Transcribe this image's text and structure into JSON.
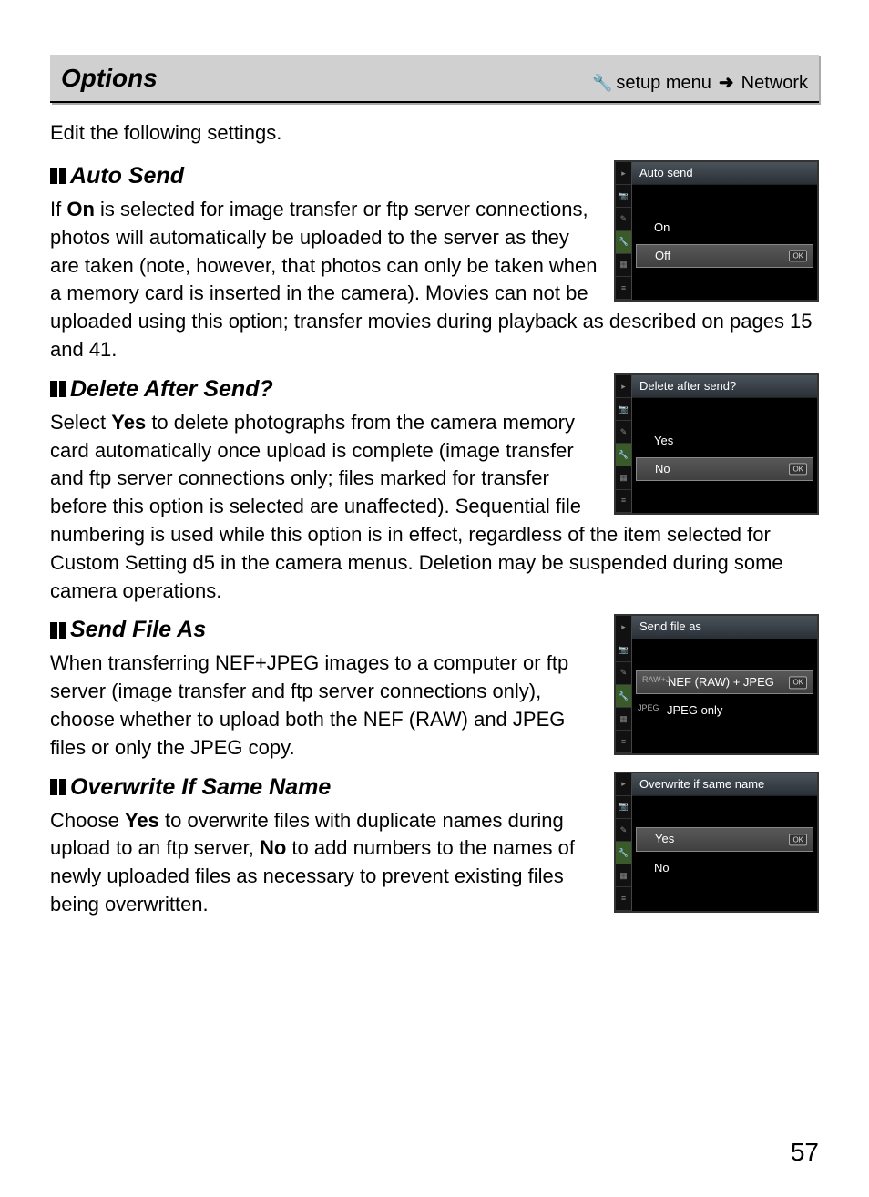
{
  "header": {
    "title": "Options",
    "breadcrumb_setup": "setup menu",
    "breadcrumb_network": "Network"
  },
  "intro": "Edit the following settings.",
  "sections": {
    "auto_send": {
      "title": "Auto Send",
      "body_pre": "If ",
      "body_on": "On",
      "body_post": " is selected for image transfer or ftp server connections, photos will automatically be uploaded to the server as they are taken (note, however, that photos can only be taken when a memory card is inserted in the camera). Movies can not be uploaded using this option; transfer movies during playback as described on pages 15 and 41.",
      "shot": {
        "title": "Auto send",
        "opt1": "On",
        "opt2": "Off",
        "selected": 2
      }
    },
    "delete_after": {
      "title": "Delete After Send?",
      "body_pre": "Select ",
      "body_yes": "Yes",
      "body_post": " to delete photographs from the camera memory card automatically once upload is complete (image transfer and ftp server connections only; files marked for transfer before this option is selected are unaffected). Sequential file numbering is used while this option is in effect, regardless of the item selected for Custom Setting d5 in the camera menus. Deletion may be suspended during some camera operations.",
      "shot": {
        "title": "Delete after send?",
        "opt1": "Yes",
        "opt2": "No",
        "selected": 2
      }
    },
    "send_file_as": {
      "title": "Send File As",
      "body": "When transferring NEF+JPEG images to a computer or ftp server (image transfer and ftp server connections only), choose whether to upload both the NEF (RAW) and JPEG files or only the JPEG copy.",
      "shot": {
        "title": "Send file as",
        "opt1p": "RAW+J",
        "opt1": "NEF (RAW) + JPEG",
        "opt2p": "JPEG",
        "opt2": "JPEG only",
        "selected": 1
      }
    },
    "overwrite": {
      "title": "Overwrite If Same Name",
      "body_pre": "Choose ",
      "body_yes": "Yes",
      "body_mid": " to overwrite files with duplicate names during upload to an ftp server, ",
      "body_no": "No",
      "body_post": " to add numbers to the names of newly uploaded files as necessary to prevent existing files being overwritten.",
      "shot": {
        "title": "Overwrite if same name",
        "opt1": "Yes",
        "opt2": "No",
        "selected": 1
      }
    }
  },
  "page_number": "57",
  "ok_label": "OK"
}
